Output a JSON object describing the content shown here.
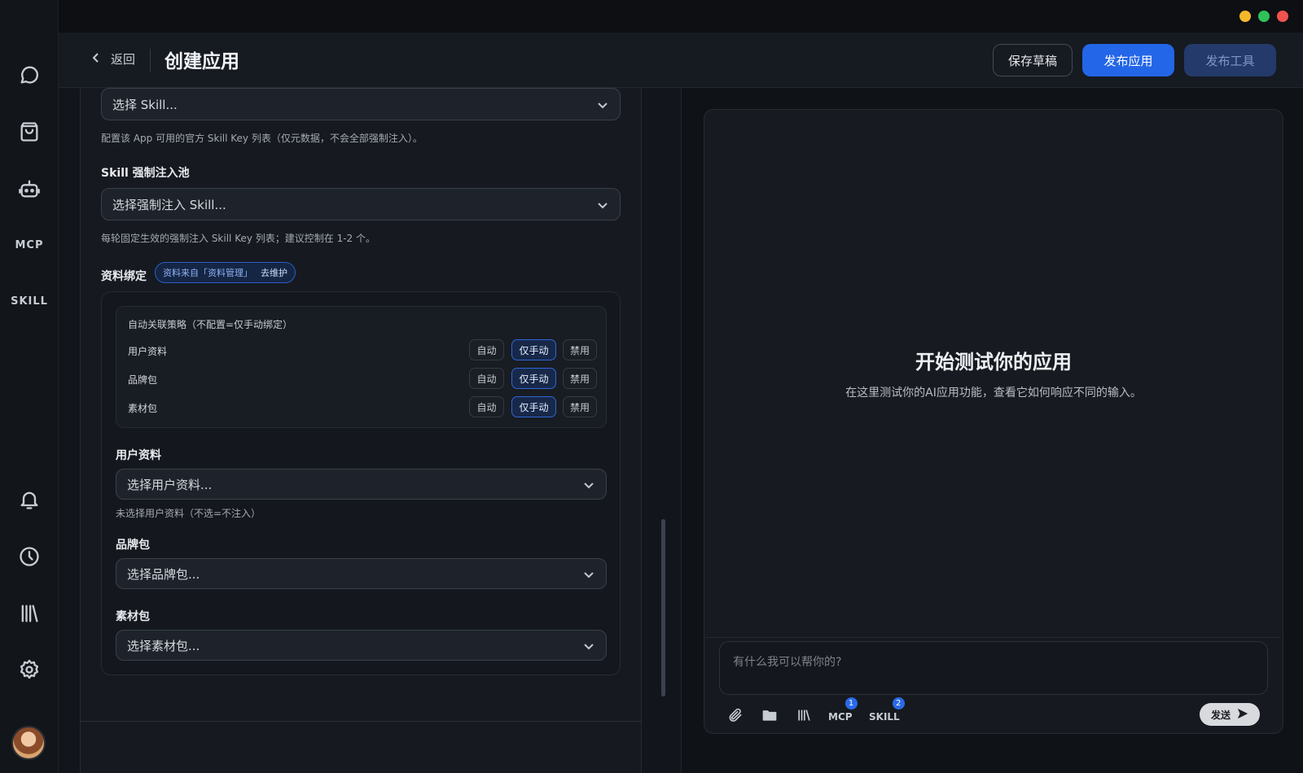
{
  "rail": {
    "mcp_label": "MCP",
    "skill_label": "SKILL",
    "icons": [
      "chat-icon",
      "bag-icon",
      "robot-icon",
      "bell-icon",
      "clock-icon",
      "library-icon",
      "gear-icon"
    ]
  },
  "window_controls": {
    "colors": [
      "#f5b82b",
      "#2fc259",
      "#f0524f"
    ]
  },
  "header": {
    "back_label": "返回",
    "title": "创建应用",
    "save_draft": "保存草稿",
    "publish_app": "发布应用",
    "publish_tool": "发布工具"
  },
  "form": {
    "skill_select_placeholder": "选择 Skill...",
    "skill_hint": "配置该 App 可用的官方 Skill Key 列表（仅元数据，不会全部强制注入）。",
    "force_pool_label": "Skill 强制注入池",
    "force_select_placeholder": "选择强制注入 Skill...",
    "force_hint": "每轮固定生效的强制注入 Skill Key 列表；建议控制在 1-2 个。",
    "binding_label": "资料绑定",
    "binding_source": "资料来自「资料管理」",
    "binding_maintain": "去维护",
    "strategy": {
      "title": "自动关联策略（不配置=仅手动绑定）",
      "options": {
        "auto": "自动",
        "manual": "仅手动",
        "disabled": "禁用"
      },
      "rows": [
        {
          "label": "用户资料",
          "selected": "manual"
        },
        {
          "label": "品牌包",
          "selected": "manual"
        },
        {
          "label": "素材包",
          "selected": "manual"
        }
      ]
    },
    "user_profile_label": "用户资料",
    "user_profile_placeholder": "选择用户资料...",
    "user_profile_hint": "未选择用户资料（不选=不注入）",
    "brand_label": "品牌包",
    "brand_placeholder": "选择品牌包...",
    "material_label": "素材包",
    "material_placeholder": "选择素材包..."
  },
  "preview": {
    "title": "开始测试你的应用",
    "subtitle": "在这里测试你的AI应用功能，查看它如何响应不同的输入。",
    "input_placeholder": "有什么我可以帮你的?",
    "mcp_label": "MCP",
    "mcp_count": "1",
    "skill_label": "SKILL",
    "skill_count": "2",
    "send_label": "发送"
  }
}
